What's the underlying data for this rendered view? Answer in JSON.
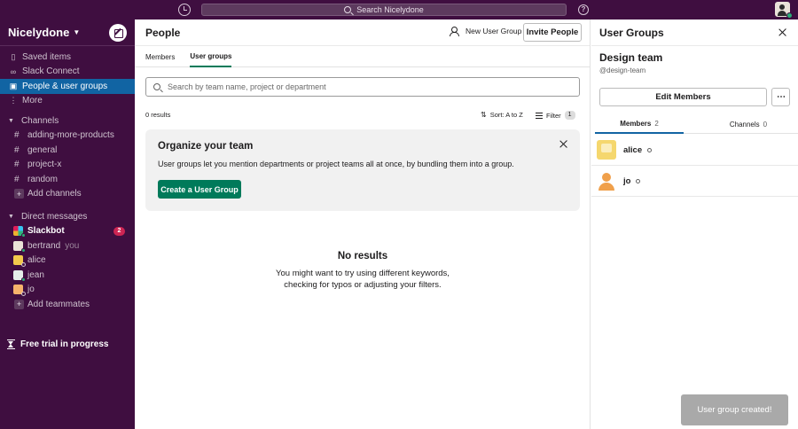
{
  "topbar": {
    "search_placeholder": "Search Nicelydone",
    "help_label": "?"
  },
  "sidebar": {
    "workspace_name": "Nicelydone",
    "nav_items": [
      {
        "label": "Saved items",
        "icon": "bookmark-icon"
      },
      {
        "label": "Slack Connect",
        "icon": "slack-connect-icon"
      },
      {
        "label": "People & user groups",
        "icon": "people-icon",
        "active": true
      },
      {
        "label": "More",
        "icon": "more-vertical-icon"
      }
    ],
    "channels_header": "Channels",
    "channels": [
      "adding-more-products",
      "general",
      "project-x",
      "random"
    ],
    "add_channels": "Add channels",
    "dm_header": "Direct messages",
    "dms": [
      {
        "name": "Slackbot",
        "badge": "2"
      },
      {
        "name": "bertrand",
        "suffix": "you"
      },
      {
        "name": "alice"
      },
      {
        "name": "jean"
      },
      {
        "name": "jo"
      }
    ],
    "add_teammates": "Add teammates",
    "trial": "Free trial in progress"
  },
  "main": {
    "title": "People",
    "new_group_label": "New User Group",
    "invite_label": "Invite People",
    "tabs": [
      {
        "label": "Members"
      },
      {
        "label": "User groups",
        "active": true
      }
    ],
    "search_placeholder": "Search by team name, project or department",
    "results_count": "0 results",
    "sort_label": "Sort: A to Z",
    "filter_label": "Filter",
    "filter_count": "1",
    "card": {
      "title": "Organize your team",
      "text": "User groups let you mention departments or project teams all at once, by bundling them into a group.",
      "button": "Create a User Group"
    },
    "empty_title": "No results",
    "empty_line1": "You might want to try using different keywords,",
    "empty_line2": "checking for typos or adjusting your filters."
  },
  "panel": {
    "title": "User Groups",
    "group_name": "Design team",
    "group_handle": "@design-team",
    "edit_label": "Edit Members",
    "more_label": "⋯",
    "tabs": [
      {
        "label": "Members",
        "count": "2",
        "active": true
      },
      {
        "label": "Channels",
        "count": "0"
      }
    ],
    "members": [
      {
        "name": "alice"
      },
      {
        "name": "jo"
      }
    ]
  },
  "toast": "User group created!",
  "colors": {
    "sidebar_bg": "#3f0e40",
    "active_nav": "#1164a3",
    "primary_button": "#007a5a",
    "badge": "#cd2553",
    "online": "#2bac76"
  }
}
